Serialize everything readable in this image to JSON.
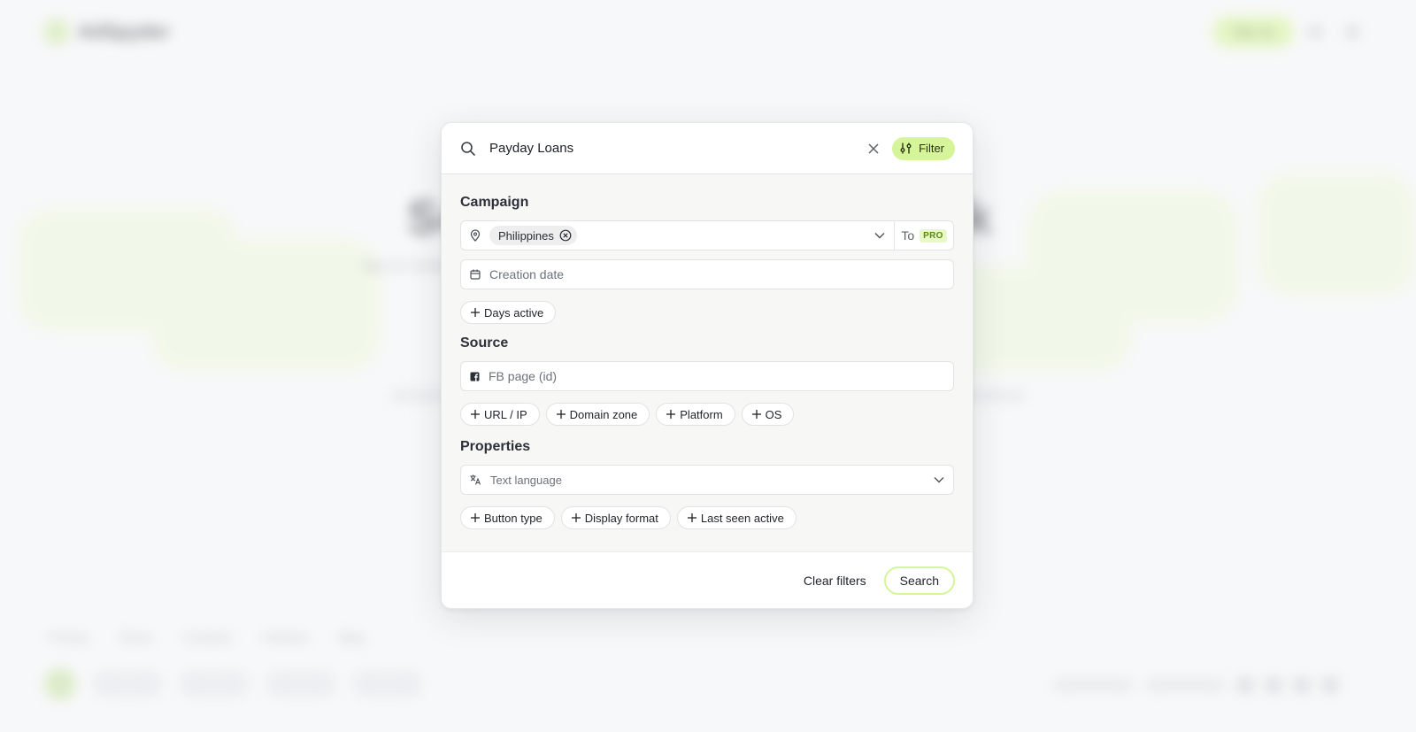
{
  "background": {
    "brand": "AdSpyder",
    "signup_label": "Sign Up",
    "hero_title": "Search ads in Facebook",
    "hero_subtitle": "Spy on competitors' ads across countries, languages and platforms",
    "footer_links": [
      "Privacy",
      "Terms",
      "Contacts",
      "Partners",
      "Blog"
    ]
  },
  "search": {
    "query": "Payday Loans",
    "filter_label": "Filter"
  },
  "campaign": {
    "title": "Campaign",
    "location_chip": "Philippines",
    "to_label": "To",
    "pro_badge": "PRO",
    "creation_date_placeholder": "Creation date",
    "pills": [
      "Days active"
    ]
  },
  "source": {
    "title": "Source",
    "fb_page_placeholder": "FB page (id)",
    "pills": [
      "URL / IP",
      "Domain zone",
      "Platform",
      "OS"
    ]
  },
  "properties": {
    "title": "Properties",
    "text_language_placeholder": "Text language",
    "pills": [
      "Button type",
      "Display format",
      "Last seen active"
    ]
  },
  "actions": {
    "clear_label": "Clear filters",
    "search_label": "Search"
  },
  "colors": {
    "accent": "#d6f59a",
    "pro_text": "#5a8a12"
  }
}
